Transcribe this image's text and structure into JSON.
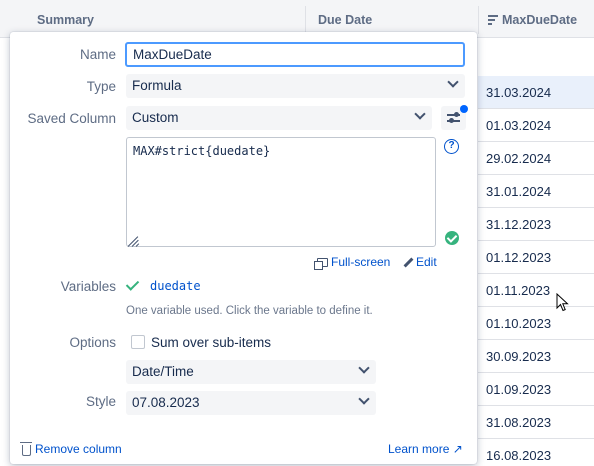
{
  "table": {
    "col_summary": "Summary",
    "col_due": "Due Date",
    "col_maxdue": "MaxDueDate",
    "rows": [
      "31.03.2024",
      "01.03.2024",
      "29.02.2024",
      "31.01.2024",
      "31.12.2023",
      "01.12.2023",
      "01.11.2023",
      "01.10.2023",
      "30.09.2023",
      "01.09.2023",
      "31.08.2023",
      "16.08.2023"
    ]
  },
  "popup": {
    "name_label": "Name",
    "name_value": "MaxDueDate",
    "type_label": "Type",
    "type_value": "Formula",
    "saved_label": "Saved Column",
    "saved_value": "Custom",
    "formula": "MAX#strict{duedate}",
    "fullscreen_label": "Full-screen",
    "edit_label": "Edit",
    "variables_label": "Variables",
    "variable_name": "duedate",
    "variable_note": "One variable used. Click the variable to define it.",
    "options_label": "Options",
    "sum_label": "Sum over sub-items",
    "format_value": "Date/Time",
    "style_label": "Style",
    "style_value": "07.08.2023",
    "remove_label": "Remove column",
    "learn_more_label": "Learn more ↗"
  },
  "icons": {
    "help": "question-circle-icon",
    "ok": "check-circle-icon",
    "settings": "sliders-icon"
  },
  "colors": {
    "accent": "#0052cc",
    "focus": "#4c9aff",
    "success": "#36b37e",
    "selected_row": "#e9f0fb"
  }
}
